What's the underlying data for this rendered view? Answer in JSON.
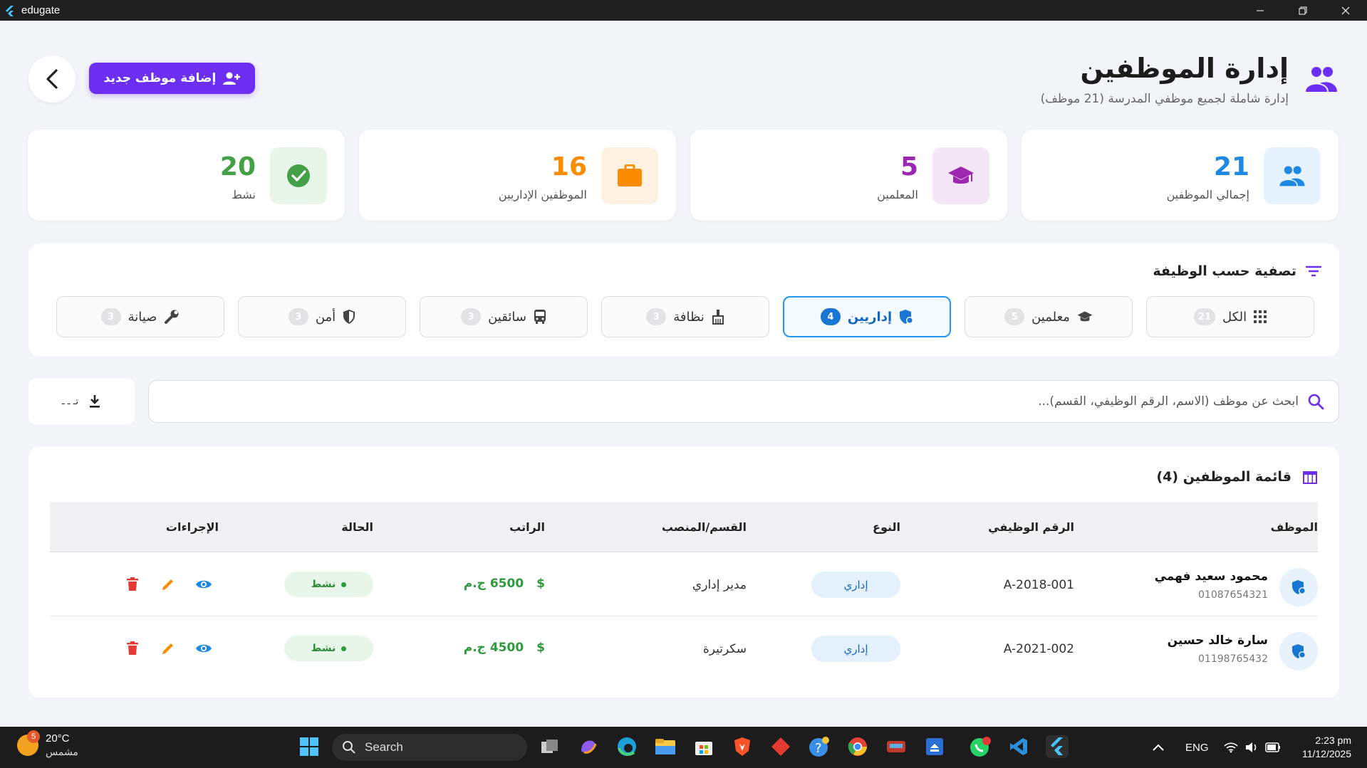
{
  "window": {
    "title": "edugate"
  },
  "header": {
    "title": "إدارة الموظفين",
    "subtitle": "إدارة شاملة لجميع موظفي المدرسة (21 موظف)",
    "add_button": "إضافة موظف جديد"
  },
  "stats": [
    {
      "value": "21",
      "label": "إجمالي الموظفين",
      "color": "#1e88e5",
      "bg": "#e6f2fd",
      "icon": "people-icon"
    },
    {
      "value": "5",
      "label": "المعلمين",
      "color": "#9c27b0",
      "bg": "#f4e6f7",
      "icon": "graduation-cap-icon"
    },
    {
      "value": "16",
      "label": "الموظفين الإداريين",
      "color": "#fb8c00",
      "bg": "#fff1e2",
      "icon": "briefcase-icon"
    },
    {
      "value": "20",
      "label": "نشط",
      "color": "#43a047",
      "bg": "#e8f5e9",
      "icon": "check-circle-icon"
    }
  ],
  "filter": {
    "title": "تصفية حسب الوظيفة",
    "chips": [
      {
        "label": "الكل",
        "count": "21",
        "icon": "grid-icon",
        "active": false
      },
      {
        "label": "معلمين",
        "count": "5",
        "icon": "graduation-cap-icon",
        "active": false
      },
      {
        "label": "إداريين",
        "count": "4",
        "icon": "admin-shield-icon",
        "active": true
      },
      {
        "label": "نظافة",
        "count": "3",
        "icon": "broom-icon",
        "active": false
      },
      {
        "label": "سائقين",
        "count": "3",
        "icon": "bus-icon",
        "active": false
      },
      {
        "label": "أمن",
        "count": "3",
        "icon": "shield-icon",
        "active": false
      },
      {
        "label": "صيانة",
        "count": "3",
        "icon": "wrench-icon",
        "active": false
      }
    ]
  },
  "search": {
    "placeholder": "ابحث عن موظف (الاسم، الرقم الوظيفي، القسم)...",
    "value": ""
  },
  "export": {
    "label": "تـ ـ ـ"
  },
  "table": {
    "title": "قائمة الموظفين (4)",
    "headers": {
      "employee": "الموظف",
      "id": "الرقم الوظيفي",
      "type": "النوع",
      "dept": "القسم/المنصب",
      "salary": "الراتب",
      "status": "الحالة",
      "actions": "الإجراءات"
    },
    "rows": [
      {
        "name": "محمود سعيد فهمي",
        "phone": "01087654321",
        "emp_id": "A-2018-001",
        "type": "إداري",
        "dept": "مدير إداري",
        "salary": "6500 ج.م",
        "status": "نشط"
      },
      {
        "name": "سارة خالد حسين",
        "phone": "01198765432",
        "emp_id": "A-2021-002",
        "type": "إداري",
        "dept": "سكرتيرة",
        "salary": "4500 ج.م",
        "status": "نشط"
      }
    ]
  },
  "taskbar": {
    "weather_temp": "20°C",
    "weather_label": "مشمس",
    "weather_badge": "5",
    "search_label": "Search",
    "lang": "ENG",
    "time": "2:23 pm",
    "date": "11/12/2025",
    "whatsapp_badge": "1"
  }
}
